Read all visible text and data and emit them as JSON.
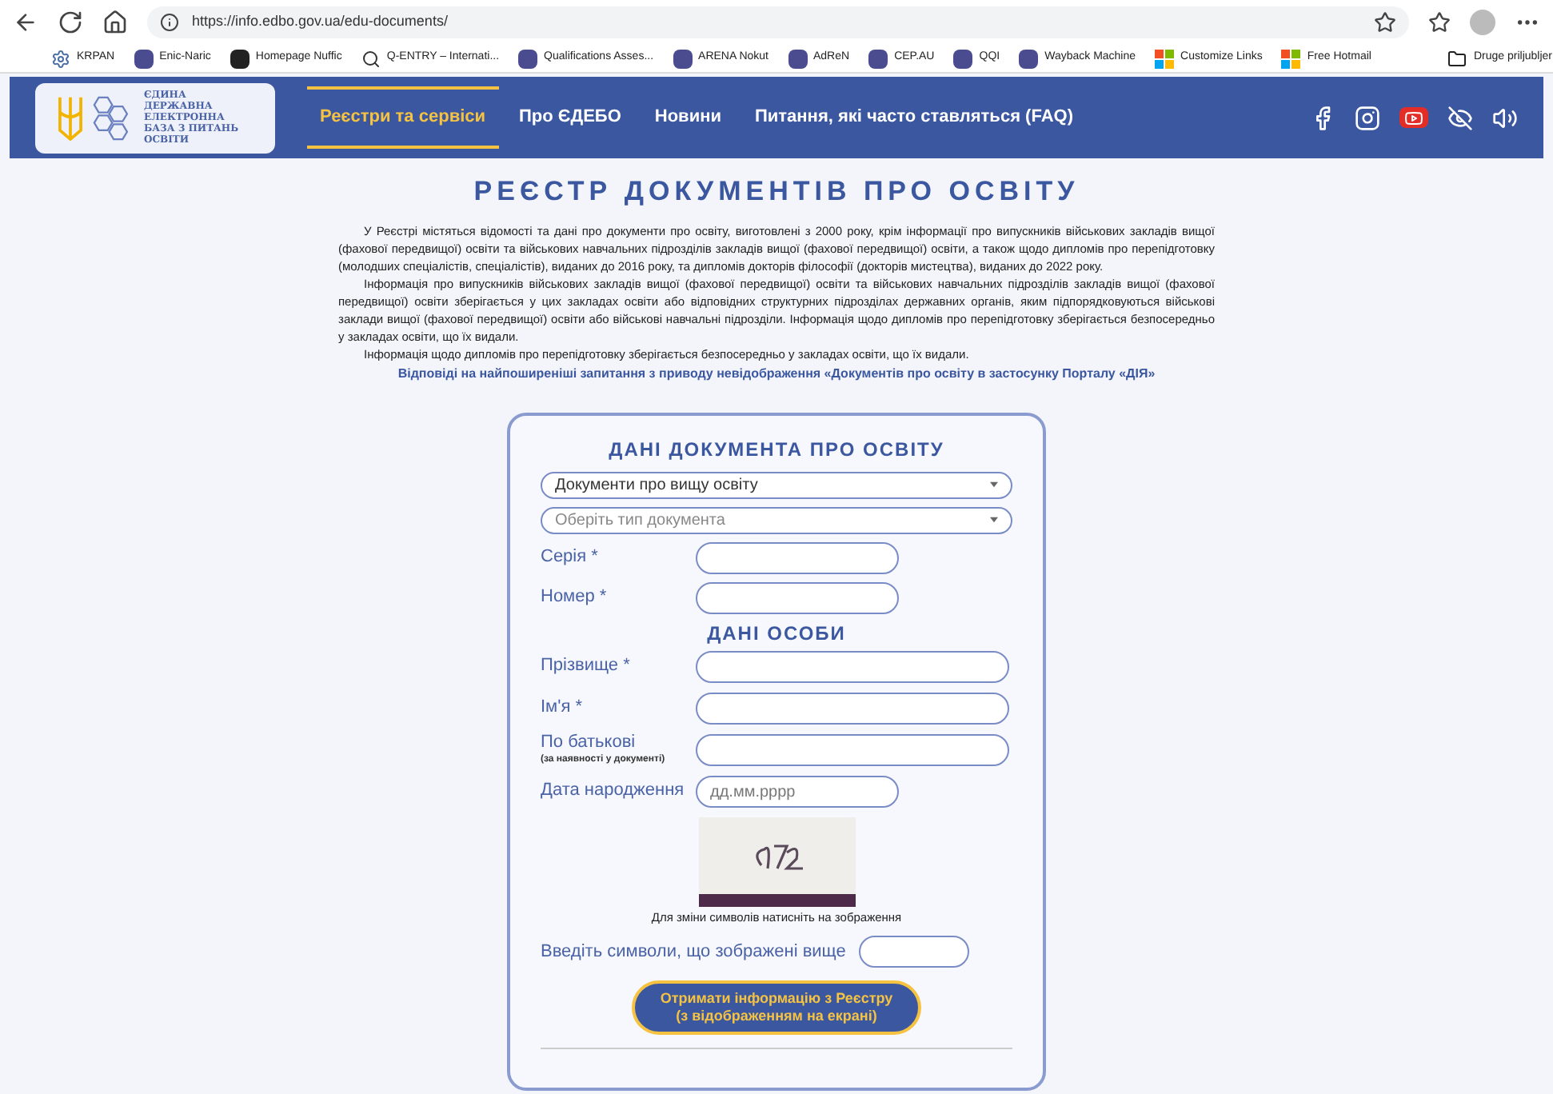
{
  "browser": {
    "url": "https://info.edbo.gov.ua/edu-documents/",
    "bookmarks": [
      {
        "label": "KRPAN"
      },
      {
        "label": "Enic-Naric"
      },
      {
        "label": "Homepage Nuffic"
      },
      {
        "label": "Q-ENTRY – Internati..."
      },
      {
        "label": "Qualifications Asses..."
      },
      {
        "label": "ARENA Nokut"
      },
      {
        "label": "AdReN"
      },
      {
        "label": "CEP.AU"
      },
      {
        "label": "QQI"
      },
      {
        "label": "Wayback Machine"
      },
      {
        "label": "Customize Links"
      },
      {
        "label": "Free Hotmail"
      }
    ],
    "other_favorites": "Druge priljubljer"
  },
  "site": {
    "logo_lines": [
      "ЄДИНА",
      "ДЕРЖАВНА",
      "ЕЛЕКТРОННА",
      "БАЗА З ПИТАНЬ",
      "ОСВІТИ"
    ],
    "nav": [
      {
        "label": "Реєстри та сервіси",
        "selected": true
      },
      {
        "label": "Про ЄДЕБО",
        "selected": false
      },
      {
        "label": "Новини",
        "selected": false
      },
      {
        "label": "Питання, які часто ставляться (FAQ)",
        "selected": false
      }
    ]
  },
  "page": {
    "title": "РЕЄСТР ДОКУМЕНТІВ ПРО ОСВІТУ",
    "paragraphs": [
      "У Реєстрі містяться відомості та дані про документи про освіту, виготовлені з 2000 року, крім інформації про випускників військових закладів вищої (фахової передвищої) освіти та військових навчальних підрозділів закладів вищої (фахової передвищої) освіти, а також щодо дипломів про перепідготовку (молодших спеціалістів, спеціалістів), виданих до 2016 року, та дипломів докторів філософії (докторів мистецтва), виданих до 2022 року.",
      "Інформація про випускників військових закладів вищої (фахової передвищої) освіти та військових навчальних підрозділів закладів вищої (фахової передвищої) освіти зберігається у цих закладах освіти або відповідних структурних підрозділах державних органів, яким підпорядковуються військові заклади вищої (фахової передвищої) освіти або військові навчальні підрозділи. Інформація щодо дипломів про перепідготовку зберігається безпосередньо у закладах освіти, що їх видали.",
      "Інформація щодо дипломів про перепідготовку зберігається безпосередньо у закладах освіти, що їх видали."
    ],
    "faq_link": "Відповіді на найпоширеніші запитання з приводу невідображення «Документів про освіту в застосунку Порталу «ДІЯ»"
  },
  "form": {
    "document_heading": "ДАНІ ДОКУМЕНТА ПРО ОСВІТУ",
    "selects": [
      {
        "value": "Документи про вищу освіту"
      },
      {
        "placeholder": "Оберіть тип документа"
      }
    ],
    "document_fields": [
      {
        "label": "Серія *"
      },
      {
        "label": "Номер *"
      }
    ],
    "person_heading": "ДАНІ ОСОБИ",
    "person_fields": [
      {
        "label": "Прізвище *",
        "kind": "text"
      },
      {
        "label": "Ім'я *",
        "kind": "text"
      },
      {
        "label": "По батькові",
        "note": "(за наявності у документі)",
        "kind": "text"
      },
      {
        "label": "Дата народження",
        "placeholder": "дд.мм.рррр",
        "kind": "date"
      }
    ],
    "captcha_hint": "Для зміни символів натисніть на зображення",
    "captcha_label": "Введіть символи, що зображені вище",
    "submit_lines": [
      "Отримати інформацію з Реєстру",
      "(з відображенням на екрані)"
    ]
  }
}
